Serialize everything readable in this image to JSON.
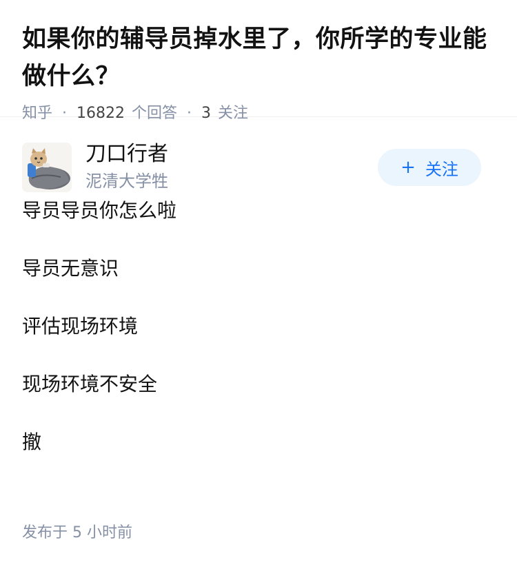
{
  "question": {
    "title": "如果你的辅导员掉水里了，你所学的专业能做什么？",
    "source": "知乎",
    "answers_count": "16822",
    "answers_label": "个回答",
    "followers_count": "3",
    "followers_label": "关注"
  },
  "author": {
    "name": "刀口行者",
    "badge": "泥清大学牲",
    "follow_label": "关注",
    "follow_icon": "plus-icon",
    "avatar_icon": "cat-in-blanket-avatar"
  },
  "answer": {
    "paragraphs": [
      "导员导员你怎么啦",
      "导员无意识",
      "评估现场环境",
      "现场环境不安全",
      "撤"
    ],
    "published_prefix": "发布于",
    "published_time": "5 小时前"
  }
}
